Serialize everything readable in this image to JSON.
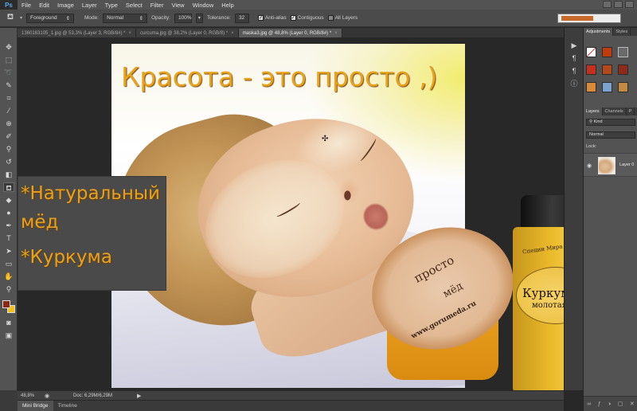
{
  "app": {
    "logo": "Ps"
  },
  "menu": [
    "File",
    "Edit",
    "Image",
    "Layer",
    "Type",
    "Select",
    "Filter",
    "View",
    "Window",
    "Help"
  ],
  "options": {
    "tool_icon": "paint-bucket-icon",
    "fill_source": "Foreground",
    "mode_label": "Mode:",
    "mode_value": "Normal",
    "opacity_label": "Opacity:",
    "opacity_value": "100%",
    "tolerance_label": "Tolerance:",
    "tolerance_value": "32",
    "anti_alias": "Anti-alias",
    "contiguous": "Contiguous",
    "all_layers": "All Layers",
    "anti_alias_checked": true,
    "contiguous_checked": true,
    "all_layers_checked": false
  },
  "tabs": [
    {
      "label": "1360163105_1.jpg @ 53,3% (Layer 3, RGB/8#) *",
      "active": false
    },
    {
      "label": "curcuma.jpg @ 38,2% (Layer 0, RGB/8) *",
      "active": false
    },
    {
      "label": "maska3.jpg @ 48,8% (Layer 0, RGB/8#) *",
      "active": true
    }
  ],
  "tab_close": "×",
  "document": {
    "headline": "Красота - это просто ,)",
    "info_lines": [
      "*Натуральный",
      "мёд",
      "*Куркума"
    ],
    "jar_text_1": "просто",
    "jar_text_2": "мёд",
    "jar_url": "www.gorumeda.ru",
    "bottle_top": "Специи Мира",
    "bottle_name": "Куркума",
    "bottle_sub": "молотая"
  },
  "panels": {
    "adjust_tabs": [
      "Adjustments",
      "Styles"
    ],
    "layer_tabs": [
      "Layers",
      "Channels",
      "P"
    ],
    "kind_label": "Kind",
    "blend_mode": "Normal",
    "lock_label": "Lock:",
    "layer_name": "Layer 0"
  },
  "status": {
    "zoom": "48,8%",
    "doc_size": "Doc: 6,29M/6,29M"
  },
  "bottom_tabs": [
    "Mini Bridge",
    "Timeline"
  ],
  "colors": {
    "foreground": "#8b2a10",
    "background": "#f2c21a",
    "accent": "#e7a11c"
  }
}
